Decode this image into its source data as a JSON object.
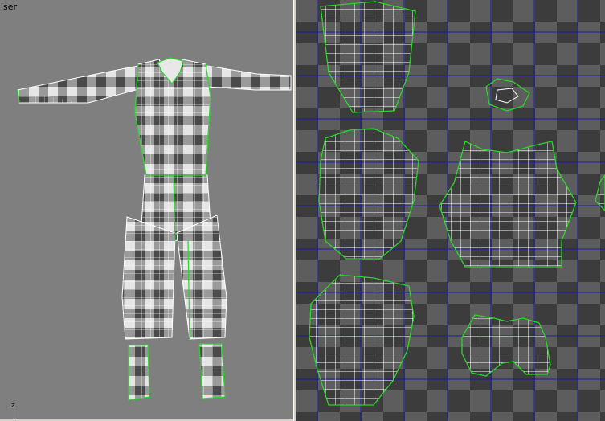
{
  "viewport": {
    "label": "lser",
    "axis_label": "z"
  },
  "uv_editor": {
    "grid_color": "#1a1aa8",
    "seam_color": "#29d629",
    "wire_color": "#ffffff"
  },
  "icons": [
    "checker-grid-icon"
  ]
}
